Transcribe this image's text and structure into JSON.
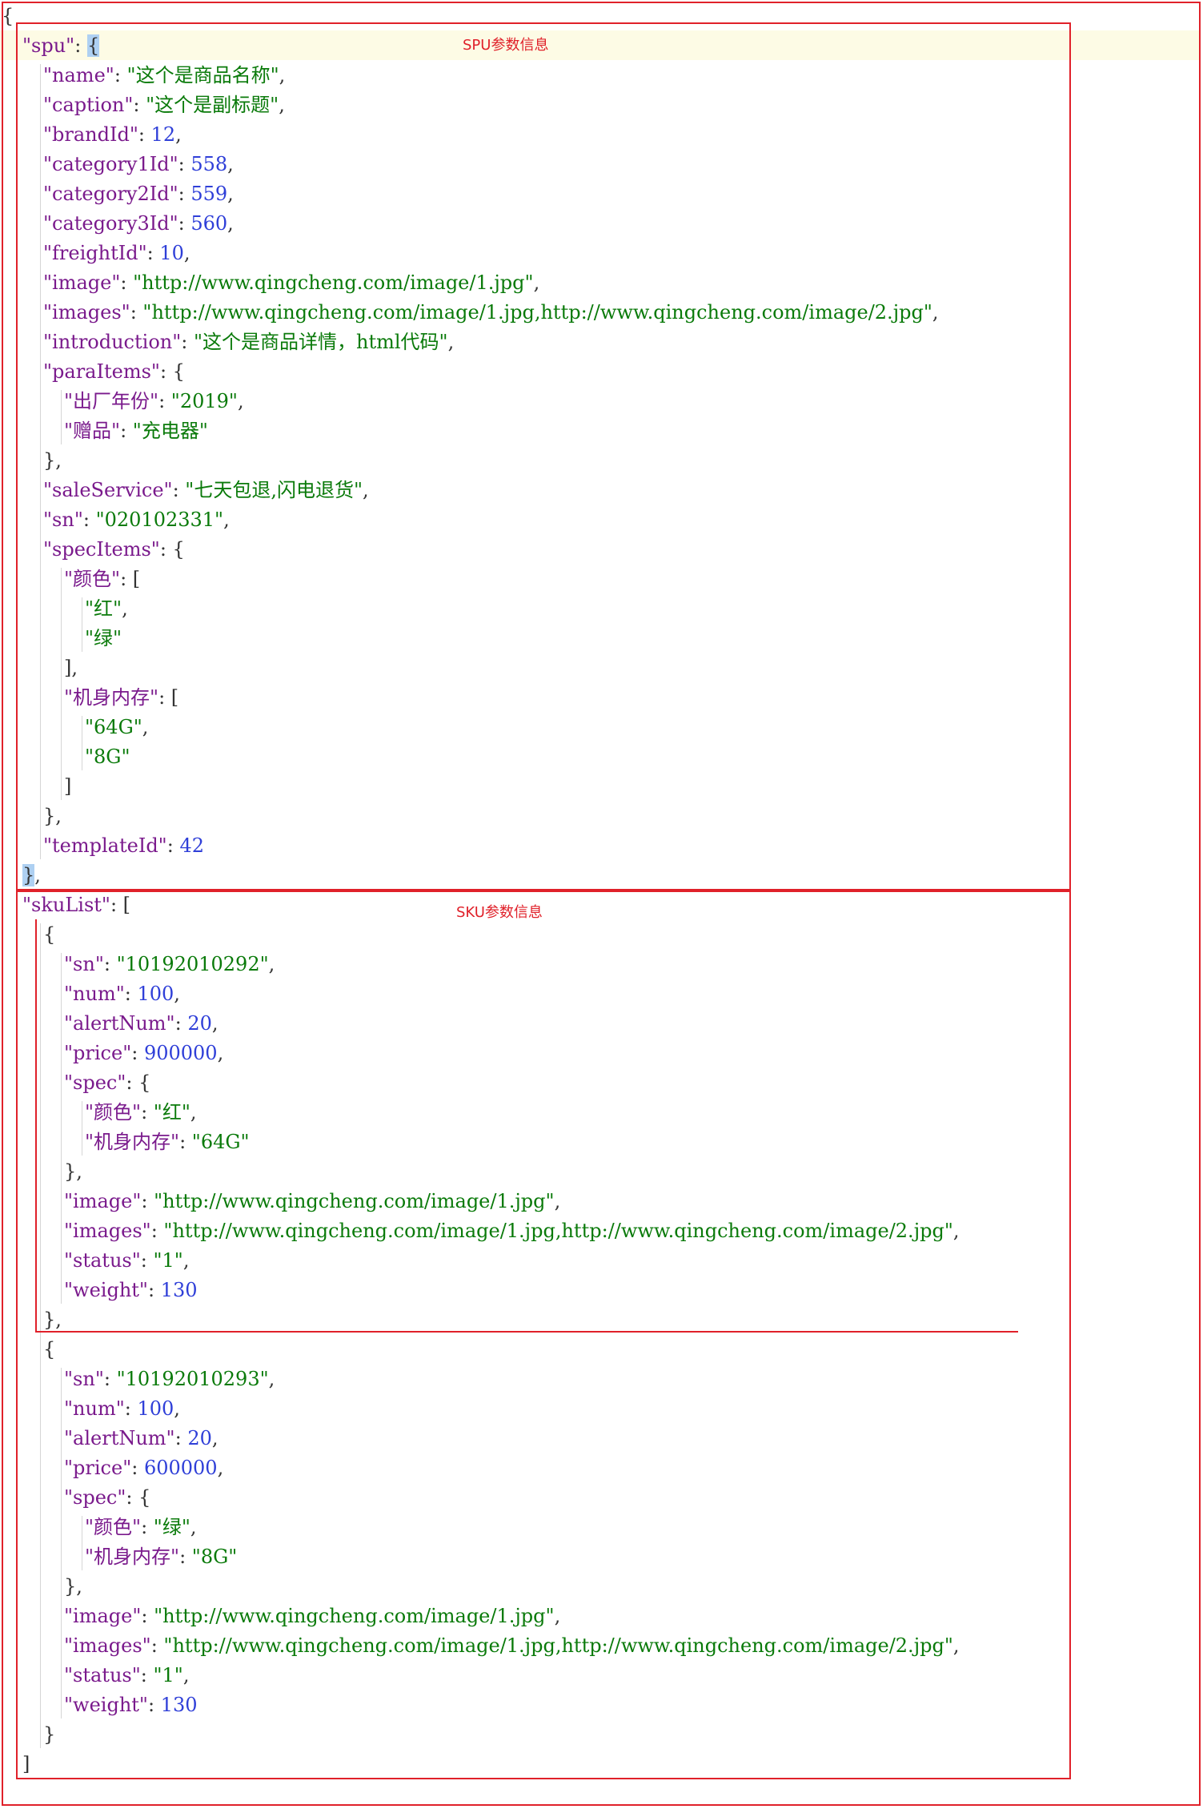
{
  "annotations": {
    "spu_label": "SPU参数信息",
    "sku_label": "SKU参数信息"
  },
  "colors": {
    "key": "#7a1a8c",
    "string": "#0a7a0a",
    "number": "#2f3fd8",
    "punctuation": "#333333",
    "box": "#e0212a",
    "current_line": "#fdfbe5",
    "brace_match": "#aed0f2"
  },
  "lines": [
    [
      [
        "p",
        "{"
      ]
    ],
    [
      [
        "k",
        "\"spu\""
      ],
      [
        "p",
        ": "
      ],
      [
        "b",
        "{"
      ]
    ],
    [
      [
        "k",
        "\"name\""
      ],
      [
        "p",
        ": "
      ],
      [
        "s",
        "\"这个是商品名称\""
      ],
      [
        "p",
        ","
      ]
    ],
    [
      [
        "k",
        "\"caption\""
      ],
      [
        "p",
        ": "
      ],
      [
        "s",
        "\"这个是副标题\""
      ],
      [
        "p",
        ","
      ]
    ],
    [
      [
        "k",
        "\"brandId\""
      ],
      [
        "p",
        ": "
      ],
      [
        "n",
        "12"
      ],
      [
        "p",
        ","
      ]
    ],
    [
      [
        "k",
        "\"category1Id\""
      ],
      [
        "p",
        ": "
      ],
      [
        "n",
        "558"
      ],
      [
        "p",
        ","
      ]
    ],
    [
      [
        "k",
        "\"category2Id\""
      ],
      [
        "p",
        ": "
      ],
      [
        "n",
        "559"
      ],
      [
        "p",
        ","
      ]
    ],
    [
      [
        "k",
        "\"category3Id\""
      ],
      [
        "p",
        ": "
      ],
      [
        "n",
        "560"
      ],
      [
        "p",
        ","
      ]
    ],
    [
      [
        "k",
        "\"freightId\""
      ],
      [
        "p",
        ": "
      ],
      [
        "n",
        "10"
      ],
      [
        "p",
        ","
      ]
    ],
    [
      [
        "k",
        "\"image\""
      ],
      [
        "p",
        ": "
      ],
      [
        "s",
        "\"http://www.qingcheng.com/image/1.jpg\""
      ],
      [
        "p",
        ","
      ]
    ],
    [
      [
        "k",
        "\"images\""
      ],
      [
        "p",
        ": "
      ],
      [
        "s",
        "\"http://www.qingcheng.com/image/1.jpg,http://www.qingcheng.com/image/2.jpg\""
      ],
      [
        "p",
        ","
      ]
    ],
    [
      [
        "k",
        "\"introduction\""
      ],
      [
        "p",
        ": "
      ],
      [
        "s",
        "\"这个是商品详情，html代码\""
      ],
      [
        "p",
        ","
      ]
    ],
    [
      [
        "k",
        "\"paraItems\""
      ],
      [
        "p",
        ": {"
      ]
    ],
    [
      [
        "k",
        "\"出厂年份\""
      ],
      [
        "p",
        ": "
      ],
      [
        "s",
        "\"2019\""
      ],
      [
        "p",
        ","
      ]
    ],
    [
      [
        "k",
        "\"赠品\""
      ],
      [
        "p",
        ": "
      ],
      [
        "s",
        "\"充电器\""
      ]
    ],
    [
      [
        "p",
        "},"
      ]
    ],
    [
      [
        "k",
        "\"saleService\""
      ],
      [
        "p",
        ": "
      ],
      [
        "s",
        "\"七天包退,闪电退货\""
      ],
      [
        "p",
        ","
      ]
    ],
    [
      [
        "k",
        "\"sn\""
      ],
      [
        "p",
        ": "
      ],
      [
        "s",
        "\"020102331\""
      ],
      [
        "p",
        ","
      ]
    ],
    [
      [
        "k",
        "\"specItems\""
      ],
      [
        "p",
        ": {"
      ]
    ],
    [
      [
        "k",
        "\"颜色\""
      ],
      [
        "p",
        ": ["
      ]
    ],
    [
      [
        "s",
        "\"红\""
      ],
      [
        "p",
        ","
      ]
    ],
    [
      [
        "s",
        "\"绿\""
      ]
    ],
    [
      [
        "p",
        "],"
      ]
    ],
    [
      [
        "k",
        "\"机身内存\""
      ],
      [
        "p",
        ": ["
      ]
    ],
    [
      [
        "s",
        "\"64G\""
      ],
      [
        "p",
        ","
      ]
    ],
    [
      [
        "s",
        "\"8G\""
      ]
    ],
    [
      [
        "p",
        "]"
      ]
    ],
    [
      [
        "p",
        "},"
      ]
    ],
    [
      [
        "k",
        "\"templateId\""
      ],
      [
        "p",
        ": "
      ],
      [
        "n",
        "42"
      ]
    ],
    [
      [
        "b",
        "}"
      ],
      [
        "p",
        ","
      ]
    ],
    [
      [
        "k",
        "\"skuList\""
      ],
      [
        "p",
        ": ["
      ]
    ],
    [
      [
        "p",
        "{"
      ]
    ],
    [
      [
        "k",
        "\"sn\""
      ],
      [
        "p",
        ": "
      ],
      [
        "s",
        "\"10192010292\""
      ],
      [
        "p",
        ","
      ]
    ],
    [
      [
        "k",
        "\"num\""
      ],
      [
        "p",
        ": "
      ],
      [
        "n",
        "100"
      ],
      [
        "p",
        ","
      ]
    ],
    [
      [
        "k",
        "\"alertNum\""
      ],
      [
        "p",
        ": "
      ],
      [
        "n",
        "20"
      ],
      [
        "p",
        ","
      ]
    ],
    [
      [
        "k",
        "\"price\""
      ],
      [
        "p",
        ": "
      ],
      [
        "n",
        "900000"
      ],
      [
        "p",
        ","
      ]
    ],
    [
      [
        "k",
        "\"spec\""
      ],
      [
        "p",
        ": {"
      ]
    ],
    [
      [
        "k",
        "\"颜色\""
      ],
      [
        "p",
        ": "
      ],
      [
        "s",
        "\"红\""
      ],
      [
        "p",
        ","
      ]
    ],
    [
      [
        "k",
        "\"机身内存\""
      ],
      [
        "p",
        ": "
      ],
      [
        "s",
        "\"64G\""
      ]
    ],
    [
      [
        "p",
        "},"
      ]
    ],
    [
      [
        "k",
        "\"image\""
      ],
      [
        "p",
        ": "
      ],
      [
        "s",
        "\"http://www.qingcheng.com/image/1.jpg\""
      ],
      [
        "p",
        ","
      ]
    ],
    [
      [
        "k",
        "\"images\""
      ],
      [
        "p",
        ": "
      ],
      [
        "s",
        "\"http://www.qingcheng.com/image/1.jpg,http://www.qingcheng.com/image/2.jpg\""
      ],
      [
        "p",
        ","
      ]
    ],
    [
      [
        "k",
        "\"status\""
      ],
      [
        "p",
        ": "
      ],
      [
        "s",
        "\"1\""
      ],
      [
        "p",
        ","
      ]
    ],
    [
      [
        "k",
        "\"weight\""
      ],
      [
        "p",
        ": "
      ],
      [
        "n",
        "130"
      ]
    ],
    [
      [
        "p",
        "},"
      ]
    ],
    [
      [
        "p",
        "{"
      ]
    ],
    [
      [
        "k",
        "\"sn\""
      ],
      [
        "p",
        ": "
      ],
      [
        "s",
        "\"10192010293\""
      ],
      [
        "p",
        ","
      ]
    ],
    [
      [
        "k",
        "\"num\""
      ],
      [
        "p",
        ": "
      ],
      [
        "n",
        "100"
      ],
      [
        "p",
        ","
      ]
    ],
    [
      [
        "k",
        "\"alertNum\""
      ],
      [
        "p",
        ": "
      ],
      [
        "n",
        "20"
      ],
      [
        "p",
        ","
      ]
    ],
    [
      [
        "k",
        "\"price\""
      ],
      [
        "p",
        ": "
      ],
      [
        "n",
        "600000"
      ],
      [
        "p",
        ","
      ]
    ],
    [
      [
        "k",
        "\"spec\""
      ],
      [
        "p",
        ": {"
      ]
    ],
    [
      [
        "k",
        "\"颜色\""
      ],
      [
        "p",
        ": "
      ],
      [
        "s",
        "\"绿\""
      ],
      [
        "p",
        ","
      ]
    ],
    [
      [
        "k",
        "\"机身内存\""
      ],
      [
        "p",
        ": "
      ],
      [
        "s",
        "\"8G\""
      ]
    ],
    [
      [
        "p",
        "},"
      ]
    ],
    [
      [
        "k",
        "\"image\""
      ],
      [
        "p",
        ": "
      ],
      [
        "s",
        "\"http://www.qingcheng.com/image/1.jpg\""
      ],
      [
        "p",
        ","
      ]
    ],
    [
      [
        "k",
        "\"images\""
      ],
      [
        "p",
        ": "
      ],
      [
        "s",
        "\"http://www.qingcheng.com/image/1.jpg,http://www.qingcheng.com/image/2.jpg\""
      ],
      [
        "p",
        ","
      ]
    ],
    [
      [
        "k",
        "\"status\""
      ],
      [
        "p",
        ": "
      ],
      [
        "s",
        "\"1\""
      ],
      [
        "p",
        ","
      ]
    ],
    [
      [
        "k",
        "\"weight\""
      ],
      [
        "p",
        ": "
      ],
      [
        "n",
        "130"
      ]
    ],
    [
      [
        "p",
        "}"
      ]
    ],
    [
      [
        "p",
        "]"
      ]
    ]
  ]
}
